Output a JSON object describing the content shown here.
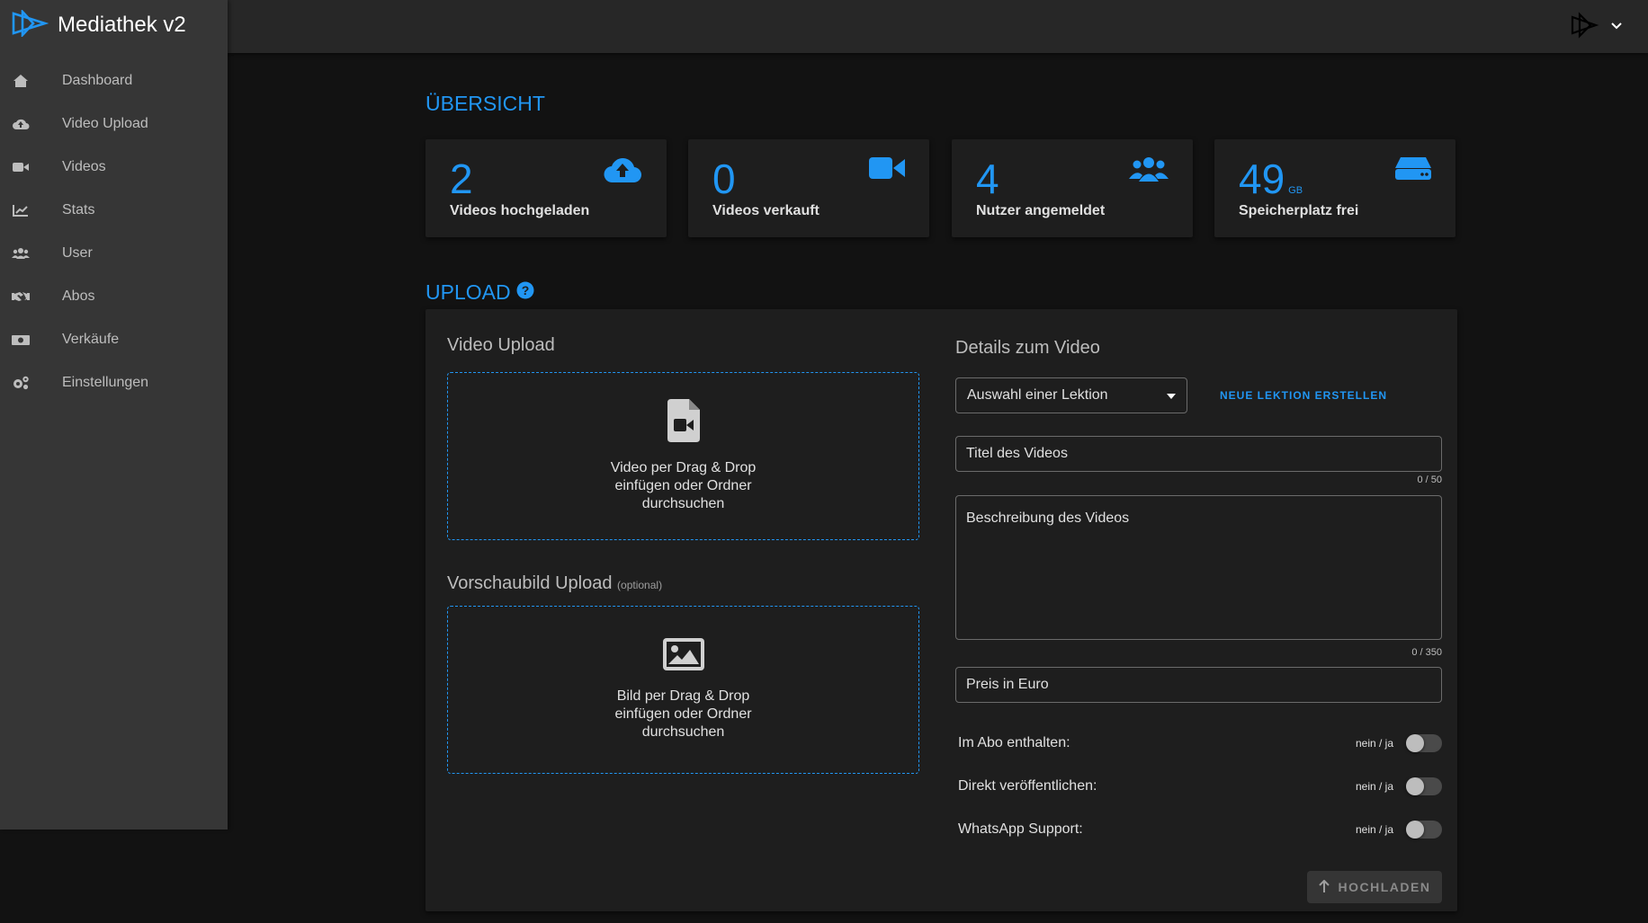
{
  "app": {
    "title": "Mediathek v2",
    "accent_color": "#2196f3"
  },
  "sidebar": {
    "items": [
      {
        "label": "Dashboard",
        "icon": "home-icon"
      },
      {
        "label": "Video Upload",
        "icon": "cloud-upload-icon"
      },
      {
        "label": "Videos",
        "icon": "video-camera-icon"
      },
      {
        "label": "Stats",
        "icon": "chart-line-icon"
      },
      {
        "label": "User",
        "icon": "users-icon"
      },
      {
        "label": "Abos",
        "icon": "handshake-icon"
      },
      {
        "label": "Verkäufe",
        "icon": "money-icon"
      },
      {
        "label": "Einstellungen",
        "icon": "cogs-icon"
      }
    ]
  },
  "overview": {
    "title": "ÜBERSICHT",
    "cards": [
      {
        "value": "2",
        "unit": "",
        "label": "Videos hochgeladen",
        "icon": "cloud-upload-icon"
      },
      {
        "value": "0",
        "unit": "",
        "label": "Videos verkauft",
        "icon": "video-camera-icon"
      },
      {
        "value": "4",
        "unit": "",
        "label": "Nutzer angemeldet",
        "icon": "users-icon"
      },
      {
        "value": "49",
        "unit": "GB",
        "label": "Speicherplatz frei",
        "icon": "hdd-icon"
      }
    ]
  },
  "upload": {
    "title": "UPLOAD",
    "video_upload": {
      "title": "Video Upload",
      "dropzone_text": "Video per Drag & Drop einfügen oder Ordner durchsuchen"
    },
    "thumbnail_upload": {
      "title": "Vorschaubild Upload",
      "optional": "(optional)",
      "dropzone_text": "Bild per Drag & Drop einfügen oder Ordner durchsuchen"
    },
    "details": {
      "title": "Details zum Video",
      "lesson_select": "Auswahl einer Lektion",
      "new_lesson_button": "NEUE LEKTION ERSTELLEN",
      "title_field": {
        "placeholder": "Titel des Videos",
        "counter": "0 / 50"
      },
      "description_field": {
        "placeholder": "Beschreibung des Videos",
        "counter": "0 / 350"
      },
      "price_field": {
        "placeholder": "Preis in Euro"
      },
      "toggles": [
        {
          "label": "Im Abo enthalten:",
          "hint": "nein / ja",
          "on": false
        },
        {
          "label": "Direkt veröffentlichen:",
          "hint": "nein / ja",
          "on": false
        },
        {
          "label": "WhatsApp Support:",
          "hint": "nein / ja",
          "on": false
        }
      ],
      "submit_button": "HOCHLADEN"
    }
  }
}
